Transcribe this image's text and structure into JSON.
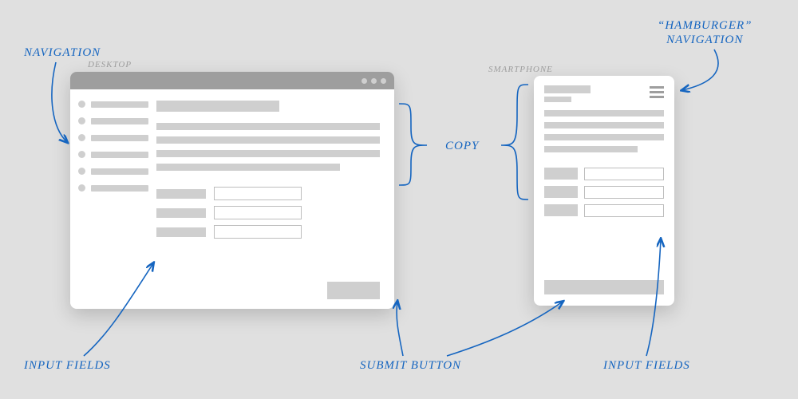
{
  "annotations": {
    "navigation": "NAVIGATION",
    "hamburger": "“HAMBURGER”\nNAVIGATION",
    "copy": "COPY",
    "input_fields_left": "INPUT FIELDS",
    "input_fields_right": "INPUT FIELDS",
    "submit_button": "SUBMIT BUTTON"
  },
  "device_labels": {
    "desktop": "DESKTOP",
    "smartphone": "SMARTPHONE"
  }
}
